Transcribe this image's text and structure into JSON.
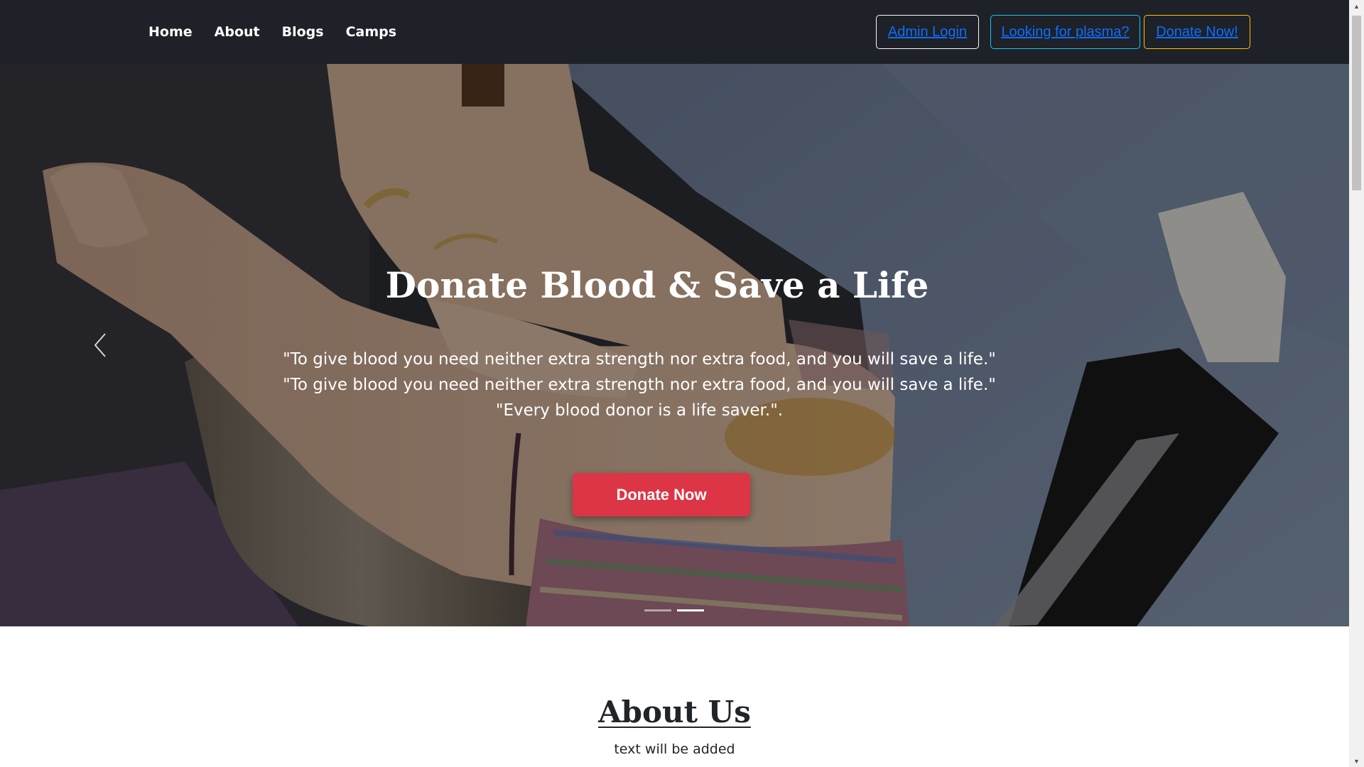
{
  "nav": {
    "links": [
      "Home",
      "About",
      "Blogs",
      "Camps"
    ],
    "admin_login": "Admin Login",
    "plasma": "Looking for plasma?",
    "donate_now": "Donate Now!"
  },
  "hero": {
    "title": "Donate Blood & Save a Life",
    "quotes": [
      "\"To give blood you need neither extra strength nor extra food, and you will save a life.\"",
      "\"To give blood you need neither extra strength nor extra food, and you will save a life.\"",
      "\"Every blood donor is a life saver.\"."
    ],
    "donate_button": "Donate Now",
    "prev_icon": "chevron-left-icon",
    "slides_count": 2,
    "active_slide": 2
  },
  "about": {
    "title": "About Us",
    "text": "text will be added"
  },
  "colors": {
    "navbar": "#1e2127",
    "link": "#0d6efd",
    "admin_border": "#f8f9fa",
    "plasma_border": "#0dcaf0",
    "donate_border": "#ffc107",
    "donate_button": "#dc3545"
  }
}
